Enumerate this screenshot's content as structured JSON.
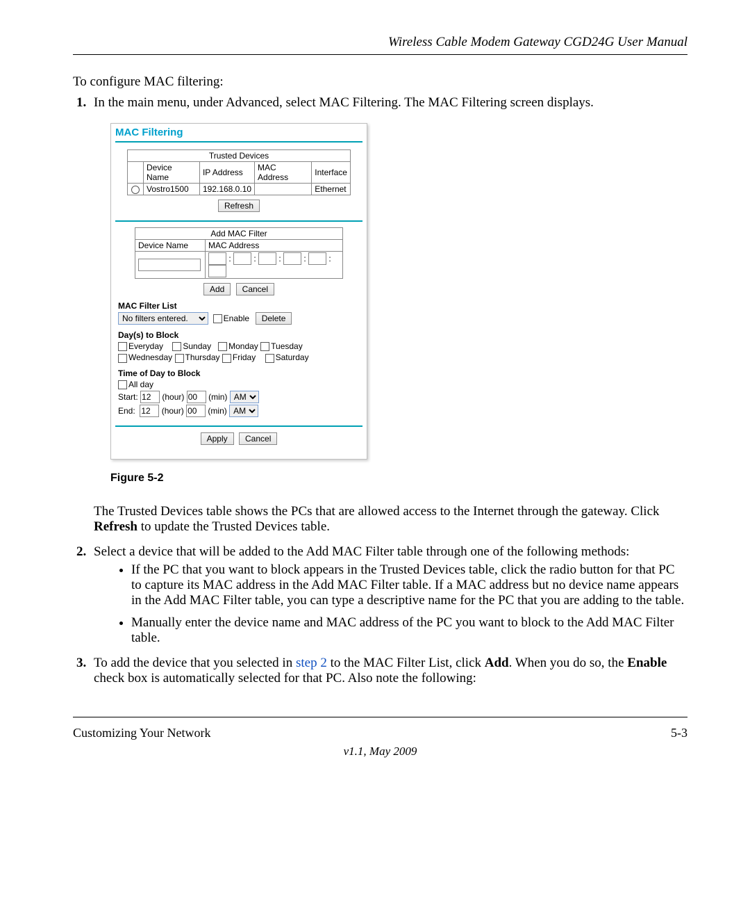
{
  "header": {
    "title": "Wireless Cable Modem Gateway CGD24G User Manual"
  },
  "intro": "To configure MAC filtering:",
  "steps": {
    "s1": "In the main menu, under Advanced, select MAC Filtering. The MAC Filtering screen displays.",
    "s2": "Select a device that will be added to the Add MAC Filter table through one of the following methods:",
    "s2_bullets": {
      "b1": "If the PC that you want to block appears in the Trusted Devices table, click the radio button for that PC to capture its MAC address in the Add MAC Filter table. If a MAC address but no device name appears in the Add MAC Filter table, you can type a descriptive name for the PC that you are adding to the table.",
      "b2": "Manually enter the device name and MAC address of the PC you want to block to the Add MAC Filter table."
    },
    "s3_pre": "To add the device that you selected in ",
    "s3_link": "step 2",
    "s3_mid": " to the MAC Filter List, click ",
    "s3_add": "Add",
    "s3_mid2": ". When you do so, the ",
    "s3_enable": "Enable",
    "s3_post": " check box is automatically selected for that PC. Also note the following:"
  },
  "figure_caption": "Figure 5-2",
  "post_fig_pre": "The Trusted Devices table shows the PCs that are allowed access to the Internet through the gateway. Click ",
  "post_fig_bold": "Refresh",
  "post_fig_post": " to update the Trusted Devices table.",
  "fig": {
    "title": "MAC Filtering",
    "trusted": {
      "header": "Trusted Devices",
      "cols": {
        "c1": "Device Name",
        "c2": "IP Address",
        "c3": "MAC Address",
        "c4": "Interface"
      },
      "row": {
        "name": "Vostro1500",
        "ip": "192.168.0.10",
        "mac": "",
        "iface": "Ethernet"
      },
      "refresh": "Refresh"
    },
    "addfilter": {
      "header": "Add MAC Filter",
      "devname": "Device Name",
      "macaddr": "MAC Address",
      "add": "Add",
      "cancel": "Cancel"
    },
    "maclist": {
      "label": "MAC Filter List",
      "none": "No filters entered.",
      "enable": "Enable",
      "delete": "Delete"
    },
    "days": {
      "label": "Day(s) to Block",
      "everyday": "Everyday",
      "sun": "Sunday",
      "mon": "Monday",
      "tue": "Tuesday",
      "wed": "Wednesday",
      "thu": "Thursday",
      "fri": "Friday",
      "sat": "Saturday"
    },
    "time": {
      "label": "Time of Day to Block",
      "allday": "All day",
      "start": "Start:",
      "end": "End:",
      "hour": "(hour)",
      "min": "(min)",
      "hval": "12",
      "mval": "00",
      "ampm": "AM"
    },
    "apply": "Apply",
    "cancel2": "Cancel"
  },
  "footer": {
    "left": "Customizing Your Network",
    "right": "5-3",
    "version": "v1.1, May 2009"
  }
}
